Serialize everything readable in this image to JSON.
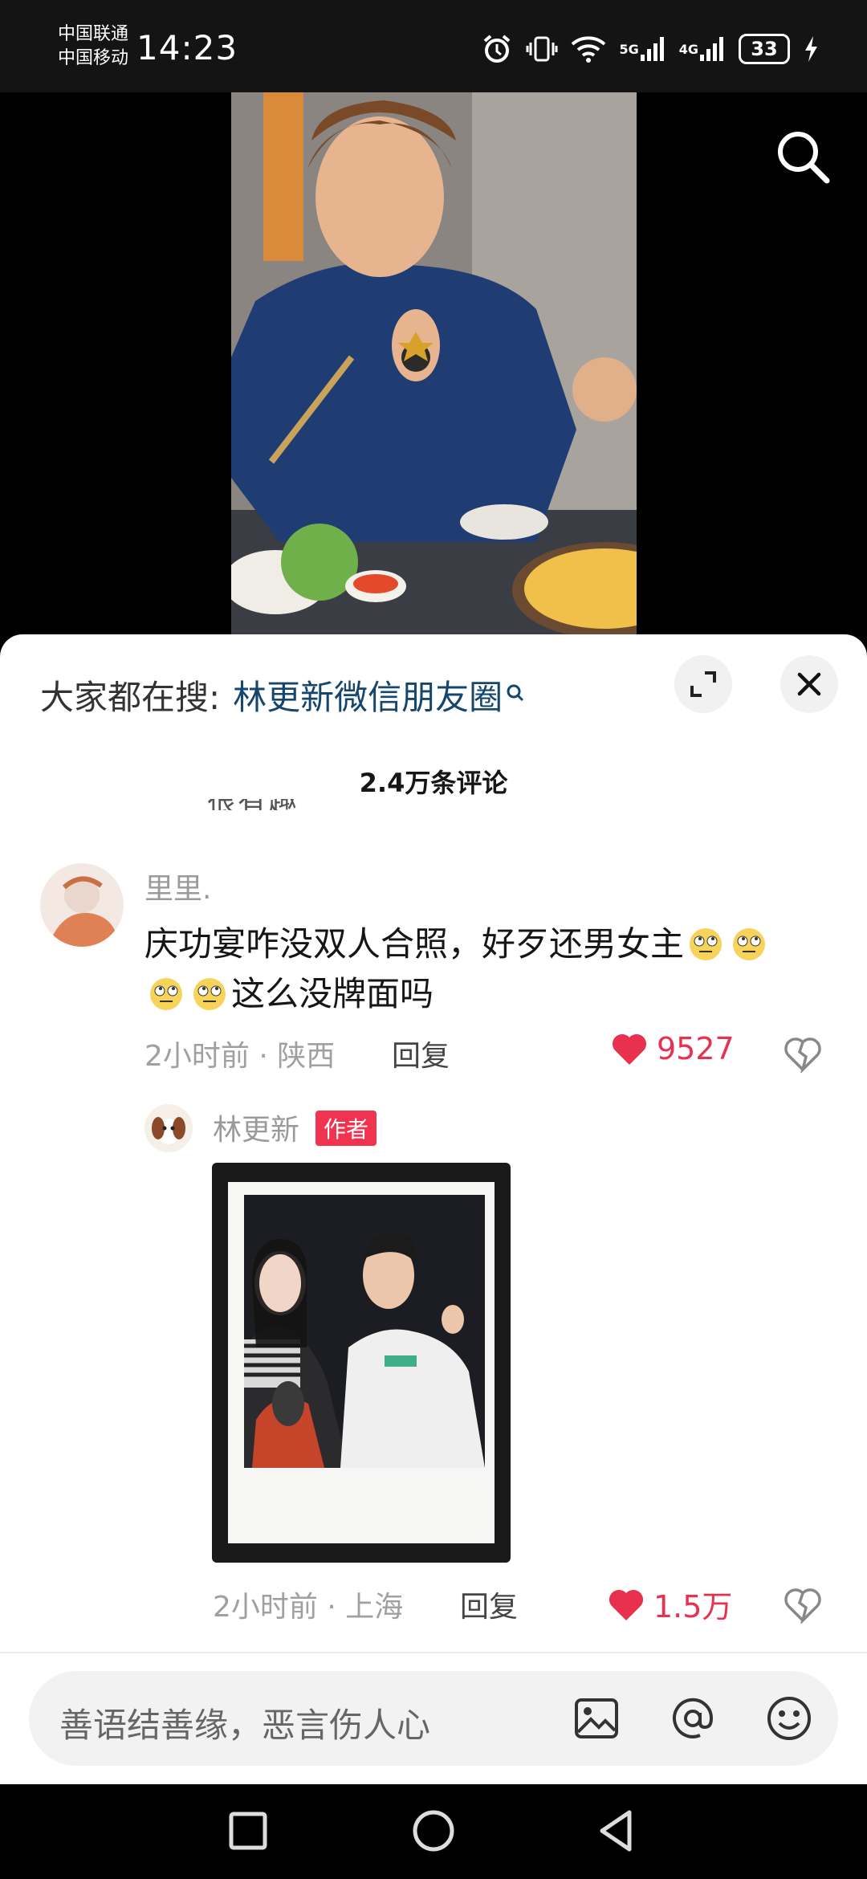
{
  "status_bar": {
    "carrier1": "中国联通",
    "carrier2": "中国移动",
    "time": "14:23",
    "net1": "5G",
    "net2": "4G",
    "battery": "33"
  },
  "video": {
    "search_icon": "search-icon"
  },
  "sheet": {
    "search_prefix": "大家都在搜:",
    "search_term": "林更新微信朋友圈",
    "comment_count": "2.4万条评论",
    "cut_text": "很有趣"
  },
  "comments": [
    {
      "user": "里里.",
      "text_part1": "庆功宴咋没双人合照，好歹还男女主",
      "text_part2": "这么没牌面吗",
      "time": "2小时前",
      "location": "陕西",
      "reply_label": "回复",
      "likes": "9527"
    },
    {
      "user": "林更新",
      "badge": "作者",
      "time": "2小时前",
      "location": "上海",
      "reply_label": "回复",
      "likes": "1.5万"
    }
  ],
  "input": {
    "placeholder": "善语结善缘，恶言伤人心"
  },
  "colors": {
    "accent_red": "#e8304f",
    "search_term": "#14466e",
    "badge": "#f0344f"
  }
}
